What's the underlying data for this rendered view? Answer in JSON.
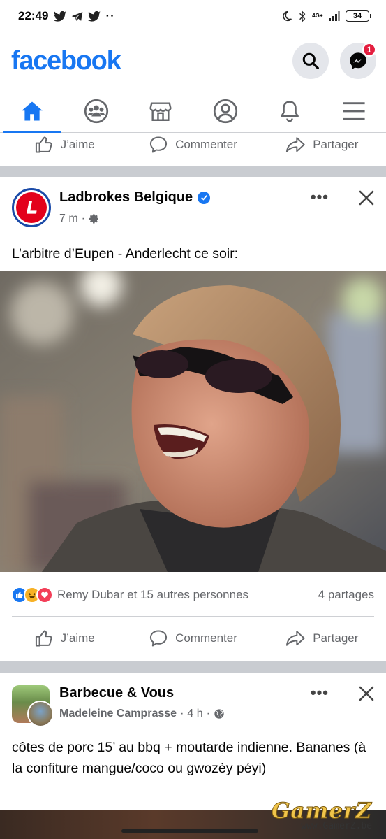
{
  "status": {
    "time": "22:49",
    "network": "4G+",
    "battery": "34"
  },
  "header": {
    "logo": "facebook",
    "messenger_badge": "1"
  },
  "tabs": [
    "home",
    "groups",
    "marketplace",
    "profile",
    "notifications",
    "menu"
  ],
  "actions": {
    "like": "J’aime",
    "comment": "Commenter",
    "share": "Partager"
  },
  "post1": {
    "author": "Ladbrokes Belgique",
    "time": "7 m",
    "text": "L’arbitre d’Eupen - Anderlecht ce soir:",
    "reactions_text": "Remy Dubar et 15 autres personnes",
    "shares": "4 partages"
  },
  "post2": {
    "author": "Barbecue & Vous",
    "poster": "Madeleine Camprasse",
    "time": "4 h",
    "text": "côtes de porc 15’ au bbq + moutarde indienne. Bananes (à la confiture mangue/coco ou gwozèy péyi)"
  },
  "watermark": {
    "brand": "GamerZ",
    "url": "www.GamerZ.be"
  },
  "colors": {
    "brand": "#1877f2",
    "secondary_text": "#65676b",
    "separator": "#c9ccd1"
  }
}
